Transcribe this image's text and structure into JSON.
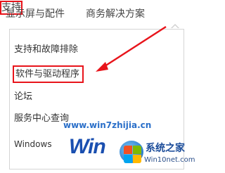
{
  "topnav": {
    "items": [
      {
        "label": "显示屏与配件"
      },
      {
        "label": "商务解决方案"
      },
      {
        "label": "支持"
      }
    ]
  },
  "dropdown": {
    "items": [
      {
        "label": "支持和故障排除"
      },
      {
        "label": "软件与驱动程序"
      },
      {
        "label": "论坛"
      },
      {
        "label": "服务中心查询"
      },
      {
        "label": "Windows"
      }
    ]
  },
  "watermark": {
    "url": "www.win7zhijia.cn",
    "logo_word": "Win",
    "brand_name": "系统之家",
    "brand_site": "Win10net.com"
  },
  "colors": {
    "highlight": "#e8141b",
    "arrow": "#e8141b"
  }
}
